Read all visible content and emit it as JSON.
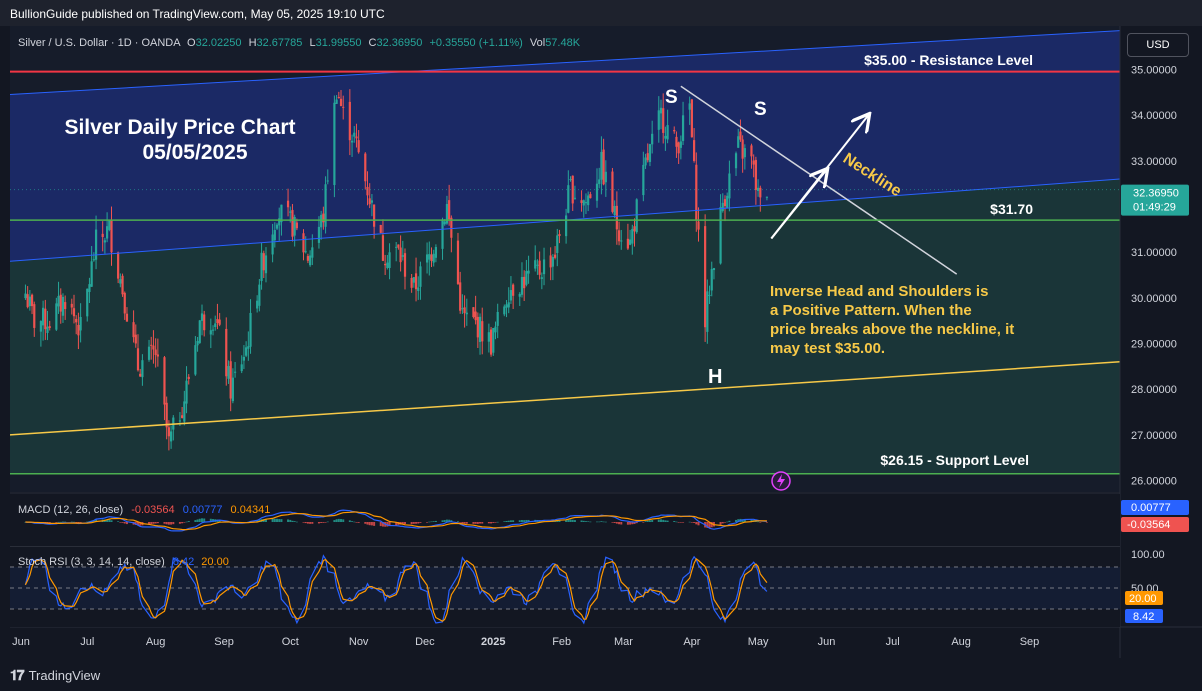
{
  "publisher": "BullionGuide published on TradingView.com, May 05, 2025 19:10 UTC",
  "header": {
    "symbol": "Silver / U.S. Dollar · 1D · OANDA",
    "o_label": "O",
    "o": "32.02250",
    "h_label": "H",
    "h": "32.67785",
    "l_label": "L",
    "l": "31.99550",
    "c_label": "C",
    "c": "32.36950",
    "change": "+0.35550 (+1.11%)",
    "vol_label": "Vol",
    "vol": "57.48K"
  },
  "currency_button": "USD",
  "chart_data": {
    "type": "candlestick",
    "title": "Silver Daily Price Chart",
    "subtitle": "05/05/2025",
    "x_tick_labels": [
      "Jun",
      "Jul",
      "Aug",
      "Sep",
      "Oct",
      "Nov",
      "Dec",
      "2025",
      "Feb",
      "Mar",
      "Apr",
      "May",
      "Jun",
      "Jul",
      "Aug",
      "Sep"
    ],
    "x_tick_positions": [
      "2024-06-01",
      "2024-07-01",
      "2024-08-01",
      "2024-09-01",
      "2024-10-01",
      "2024-11-01",
      "2024-12-01",
      "2025-01-01",
      "2025-02-01",
      "2025-03-01",
      "2025-04-01",
      "2025-05-01",
      "2025-06-01",
      "2025-07-01",
      "2025-08-01",
      "2025-09-01"
    ],
    "x_range": [
      "2024-05-27",
      "2025-10-12"
    ],
    "y_tick_labels": [
      "35.00000",
      "34.00000",
      "33.00000",
      "32.00000",
      "31.00000",
      "30.00000",
      "29.00000",
      "28.00000",
      "27.00000",
      "26.00000"
    ],
    "ylim": [
      25.75,
      35.95
    ],
    "last_price": "32.36950",
    "last_price_value": 32.3695,
    "countdown": "01:49:29",
    "grid": false,
    "up_color": "#26a69a",
    "down_color": "#ef5350",
    "close_series": [
      {
        "date": "2024-06-01",
        "close": 30.4
      },
      {
        "date": "2024-06-07",
        "close": 29.5
      },
      {
        "date": "2024-06-14",
        "close": 29.5
      },
      {
        "date": "2024-06-21",
        "close": 30.0
      },
      {
        "date": "2024-06-28",
        "close": 29.3
      },
      {
        "date": "2024-07-05",
        "close": 31.2
      },
      {
        "date": "2024-07-11",
        "close": 31.5
      },
      {
        "date": "2024-07-17",
        "close": 30.2
      },
      {
        "date": "2024-07-24",
        "close": 28.5
      },
      {
        "date": "2024-08-01",
        "close": 28.8
      },
      {
        "date": "2024-08-07",
        "close": 26.8
      },
      {
        "date": "2024-08-14",
        "close": 27.8
      },
      {
        "date": "2024-08-21",
        "close": 29.5
      },
      {
        "date": "2024-08-28",
        "close": 29.6
      },
      {
        "date": "2024-09-04",
        "close": 28.0
      },
      {
        "date": "2024-09-11",
        "close": 28.9
      },
      {
        "date": "2024-09-18",
        "close": 30.7
      },
      {
        "date": "2024-09-25",
        "close": 31.9
      },
      {
        "date": "2024-10-02",
        "close": 31.6
      },
      {
        "date": "2024-10-09",
        "close": 30.9
      },
      {
        "date": "2024-10-16",
        "close": 31.8
      },
      {
        "date": "2024-10-22",
        "close": 34.6
      },
      {
        "date": "2024-10-25",
        "close": 34.0
      },
      {
        "date": "2024-10-30",
        "close": 33.5
      },
      {
        "date": "2024-11-05",
        "close": 32.4
      },
      {
        "date": "2024-11-12",
        "close": 31.0
      },
      {
        "date": "2024-11-19",
        "close": 31.0
      },
      {
        "date": "2024-11-26",
        "close": 30.2
      },
      {
        "date": "2024-12-03",
        "close": 30.9
      },
      {
        "date": "2024-12-11",
        "close": 32.0
      },
      {
        "date": "2024-12-18",
        "close": 29.6
      },
      {
        "date": "2024-12-25",
        "close": 29.4
      },
      {
        "date": "2024-12-31",
        "close": 29.0
      },
      {
        "date": "2025-01-08",
        "close": 30.2
      },
      {
        "date": "2025-01-15",
        "close": 30.4
      },
      {
        "date": "2025-01-22",
        "close": 30.6
      },
      {
        "date": "2025-01-29",
        "close": 31.0
      },
      {
        "date": "2025-02-05",
        "close": 32.4
      },
      {
        "date": "2025-02-12",
        "close": 32.1
      },
      {
        "date": "2025-02-19",
        "close": 32.9
      },
      {
        "date": "2025-02-26",
        "close": 31.6
      },
      {
        "date": "2025-03-04",
        "close": 31.2
      },
      {
        "date": "2025-03-11",
        "close": 32.9
      },
      {
        "date": "2025-03-18",
        "close": 34.0
      },
      {
        "date": "2025-03-25",
        "close": 33.3
      },
      {
        "date": "2025-03-31",
        "close": 34.2
      },
      {
        "date": "2025-04-03",
        "close": 32.0
      },
      {
        "date": "2025-04-07",
        "close": 29.5
      },
      {
        "date": "2025-04-10",
        "close": 30.6
      },
      {
        "date": "2025-04-15",
        "close": 32.1
      },
      {
        "date": "2025-04-22",
        "close": 33.3
      },
      {
        "date": "2025-04-28",
        "close": 33.0
      },
      {
        "date": "2025-05-02",
        "close": 32.0
      },
      {
        "date": "2025-05-05",
        "close": 32.37
      }
    ],
    "horizontal_lines": [
      {
        "name": "resistance",
        "value": 34.95,
        "color": "#f23645"
      },
      {
        "name": "neckline-support",
        "value": 31.7,
        "color": "#4caf50"
      },
      {
        "name": "support",
        "value": 26.15,
        "color": "#4caf50"
      }
    ],
    "trend_lines": {
      "upper_channel": {
        "color": "#2962ff",
        "points": [
          [
            "2024-05-27",
            34.45
          ],
          [
            "2025-10-12",
            35.85
          ]
        ]
      },
      "lower_channel": {
        "color": "#2962ff",
        "points": [
          [
            "2024-05-27",
            30.8
          ],
          [
            "2025-10-12",
            32.6
          ]
        ]
      },
      "bottom_trend": {
        "color": "#f7c948",
        "points": [
          [
            "2024-05-27",
            27.0
          ],
          [
            "2025-10-12",
            28.6
          ]
        ]
      },
      "neckline": {
        "color": "#d1d4dc",
        "points": [
          [
            "2025-03-27",
            34.63
          ],
          [
            "2025-07-30",
            30.52
          ]
        ]
      }
    },
    "arrows": [
      {
        "points": [
          [
            "2025-05-07",
            31.3
          ],
          [
            "2025-06-01",
            32.8
          ]
        ]
      },
      {
        "points": [
          [
            "2025-05-07",
            31.3
          ],
          [
            "2025-06-20",
            34.0
          ]
        ]
      }
    ],
    "annotations": {
      "resistance_label": "$35.00 - Resistance Level",
      "level_label": "$31.70",
      "support_label": "$26.15 - Support Level",
      "neckline_label": "Neckline",
      "left_shoulder": "S",
      "right_shoulder": "S",
      "head": "H",
      "note": "Inverse Head and Shoulders is a Positive Pattern. When the price breaks above the neckline, it may test $35.00."
    },
    "indicators": [
      {
        "name": "MACD",
        "legend": "MACD (12, 26, close)",
        "values": [
          "-0.03564",
          "0.00777",
          "0.04341"
        ],
        "value_colors": [
          "#ef5350",
          "#2962ff",
          "#ff9800"
        ],
        "axis_badges": [
          "0.00777",
          "-0.03564"
        ],
        "series": [
          {
            "name": "macd",
            "color": "#2962ff"
          },
          {
            "name": "signal",
            "color": "#ff9800"
          }
        ]
      },
      {
        "name": "Stoch RSI",
        "legend": "Stoch RSI (3, 3, 14, 14, close)",
        "values": [
          "8.42",
          "20.00"
        ],
        "value_colors": [
          "#2962ff",
          "#ff9800"
        ],
        "axis_labels": [
          "100.00",
          "50.00"
        ],
        "axis_badges": [
          "20.00",
          "8.42"
        ],
        "levels": [
          80,
          50,
          20
        ],
        "ylim": [
          0,
          100
        ]
      }
    ]
  },
  "footer": {
    "logo_text": "TradingView"
  }
}
